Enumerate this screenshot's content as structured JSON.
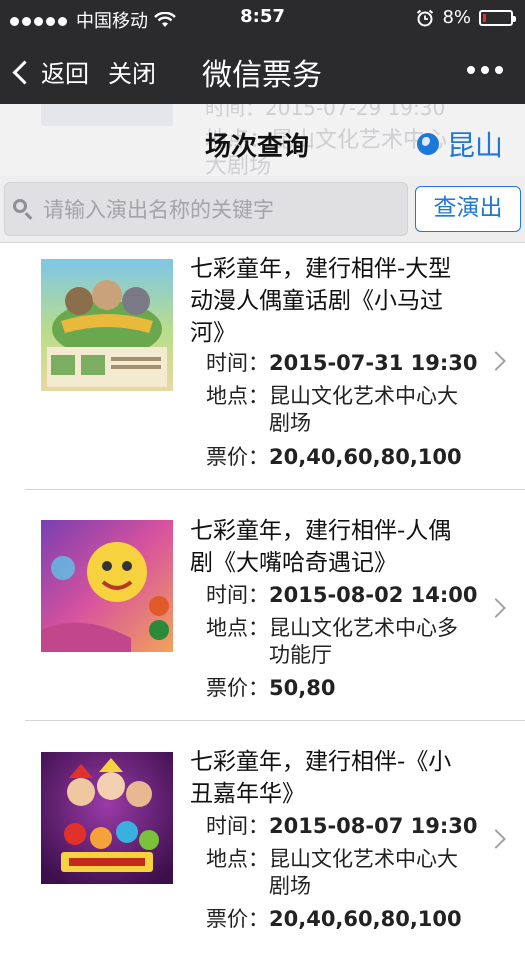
{
  "status_bar": {
    "carrier": "中国移动",
    "time": "8:57",
    "battery": "8%",
    "signal_icon": "signal-dots-icon",
    "wifi_icon": "wifi-icon",
    "alarm_icon": "alarm-clock-icon",
    "battery_color": "#e0312b"
  },
  "nav": {
    "back_label": "返回",
    "close_label": "关闭",
    "title": "微信票务",
    "more_icon": "more-dots-icon"
  },
  "subheader": {
    "title": "场次查询",
    "city": "昆山",
    "city_icon": "globe-icon",
    "accent_color": "#1e78d7"
  },
  "search": {
    "placeholder": "请输入演出名称的关键字",
    "value": "",
    "button_label": "查演出"
  },
  "events": [
    {
      "title": "七彩童年，建行相伴-大型动漫人偶童话剧《小马过河》",
      "time_label": "时间：",
      "time": "2015-07-31 19:30",
      "location_label": "地点：",
      "location": "昆山文化艺术中心大剧场",
      "price_label": "票价：",
      "price": "20,40,60,80,100"
    },
    {
      "title": "七彩童年，建行相伴-人偶剧《大嘴哈奇遇记》",
      "time_label": "时间：",
      "time": "2015-08-02 14:00",
      "location_label": "地点：",
      "location": "昆山文化艺术中心多功能厅",
      "price_label": "票价：",
      "price": "50,80"
    },
    {
      "title": "七彩童年，建行相伴-《小丑嘉年华》",
      "time_label": "时间：",
      "time": "2015-08-07 19:30",
      "location_label": "地点：",
      "location": "昆山文化艺术中心大剧场",
      "price_label": "票价：",
      "price": "20,40,60,80,100"
    }
  ]
}
